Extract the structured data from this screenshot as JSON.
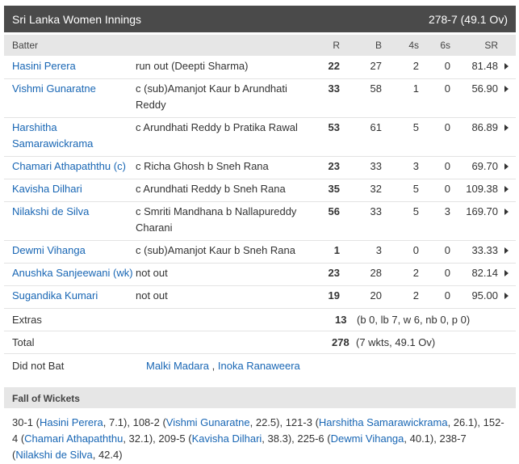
{
  "header": {
    "title": "Sri Lanka Women Innings",
    "score": "278-7 (49.1 Ov)"
  },
  "columns": {
    "batter": "Batter",
    "r": "R",
    "b": "B",
    "fours": "4s",
    "sixes": "6s",
    "sr": "SR"
  },
  "batters": [
    {
      "name": "Hasini Perera",
      "dismissal": "run out (Deepti Sharma)",
      "r": "22",
      "b": "27",
      "fours": "2",
      "sixes": "0",
      "sr": "81.48"
    },
    {
      "name": "Vishmi Gunaratne",
      "dismissal": "c (sub)Amanjot Kaur b Arundhati Reddy",
      "r": "33",
      "b": "58",
      "fours": "1",
      "sixes": "0",
      "sr": "56.90"
    },
    {
      "name": "Harshitha Samarawickrama",
      "dismissal": "c Arundhati Reddy b Pratika Rawal",
      "r": "53",
      "b": "61",
      "fours": "5",
      "sixes": "0",
      "sr": "86.89"
    },
    {
      "name": "Chamari Athapaththu (c)",
      "dismissal": "c Richa Ghosh b Sneh Rana",
      "r": "23",
      "b": "33",
      "fours": "3",
      "sixes": "0",
      "sr": "69.70"
    },
    {
      "name": "Kavisha Dilhari",
      "dismissal": "c Arundhati Reddy b Sneh Rana",
      "r": "35",
      "b": "32",
      "fours": "5",
      "sixes": "0",
      "sr": "109.38"
    },
    {
      "name": "Nilakshi de Silva",
      "dismissal": "c Smriti Mandhana b Nallapureddy Charani",
      "r": "56",
      "b": "33",
      "fours": "5",
      "sixes": "3",
      "sr": "169.70"
    },
    {
      "name": "Dewmi Vihanga",
      "dismissal": "c (sub)Amanjot Kaur b Sneh Rana",
      "r": "1",
      "b": "3",
      "fours": "0",
      "sixes": "0",
      "sr": "33.33"
    },
    {
      "name": "Anushka Sanjeewani (wk)",
      "dismissal": "not out",
      "r": "23",
      "b": "28",
      "fours": "2",
      "sixes": "0",
      "sr": "82.14"
    },
    {
      "name": "Sugandika Kumari",
      "dismissal": "not out",
      "r": "19",
      "b": "20",
      "fours": "2",
      "sixes": "0",
      "sr": "95.00"
    }
  ],
  "extras": {
    "label": "Extras",
    "value": "13",
    "detail": "(b 0, lb 7, w 6, nb 0, p 0)"
  },
  "total": {
    "label": "Total",
    "value": "278",
    "detail": "(7 wkts, 49.1 Ov)"
  },
  "did_not_bat": {
    "label": "Did not Bat",
    "players": [
      "Malki Madara",
      "Inoka Ranaweera"
    ],
    "sep": " , "
  },
  "fall_of_wickets": {
    "heading": "Fall of Wickets",
    "items": [
      {
        "score": "30-1",
        "name": "Hasini Perera",
        "over": "7.1"
      },
      {
        "score": "108-2",
        "name": "Vishmi Gunaratne",
        "over": "22.5"
      },
      {
        "score": "121-3",
        "name": "Harshitha Samarawickrama",
        "over": "26.1"
      },
      {
        "score": "152-4",
        "name": "Chamari Athapaththu",
        "over": "32.1"
      },
      {
        "score": "209-5",
        "name": "Kavisha Dilhari",
        "over": "38.3"
      },
      {
        "score": "225-6",
        "name": "Dewmi Vihanga",
        "over": "40.1"
      },
      {
        "score": "238-7",
        "name": "Nilakshi de Silva",
        "over": "42.4"
      }
    ]
  }
}
